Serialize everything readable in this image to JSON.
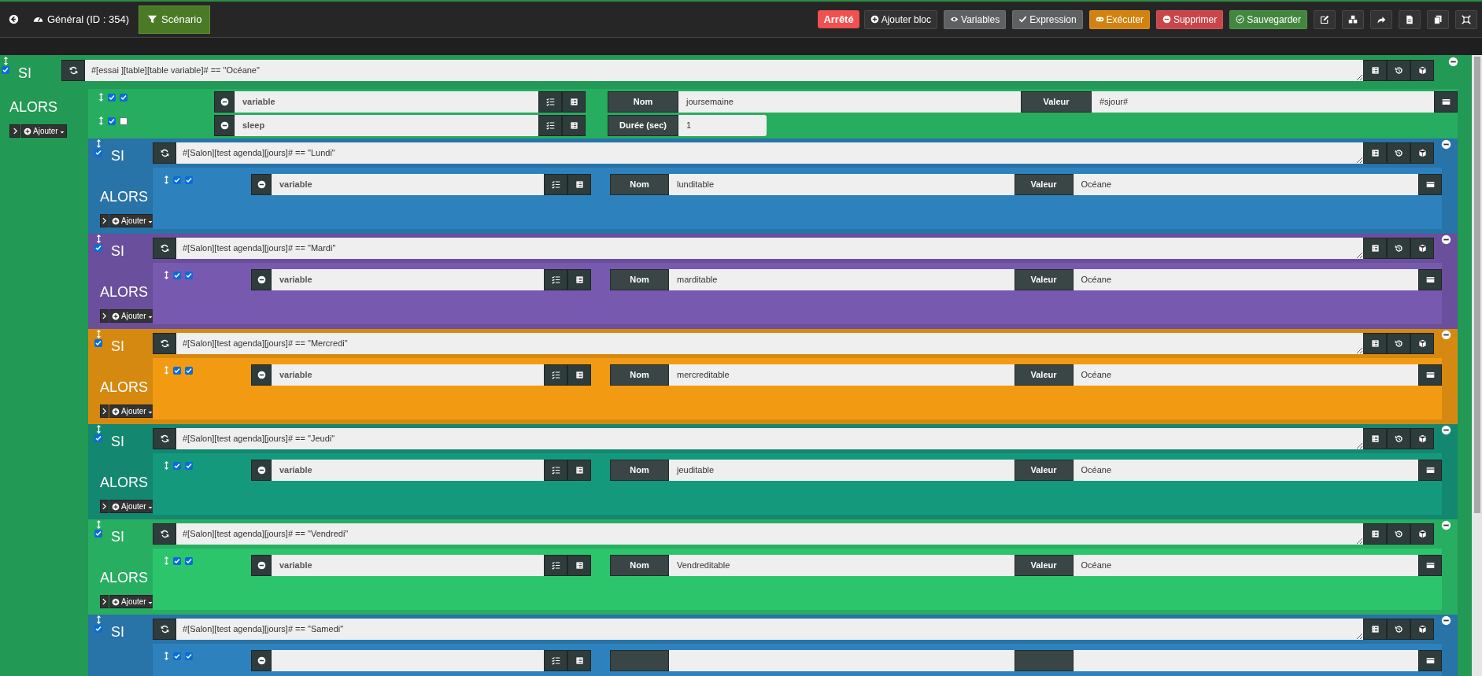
{
  "tabs": [
    {
      "label": "Général (ID : 354)",
      "selected": false
    },
    {
      "label": "Scénario",
      "selected": true
    }
  ],
  "status": "Arrêté",
  "toolbar": [
    {
      "label": "Ajouter bloc",
      "color": "#333333"
    },
    {
      "label": "Variables",
      "color": "#5e6162"
    },
    {
      "label": "Expression",
      "color": "#5e6162"
    },
    {
      "label": "Exécuter",
      "color": "#d4820f"
    },
    {
      "label": "Supprimer",
      "color": "#c9454a"
    },
    {
      "label": "Sauvegarder",
      "color": "#43873f"
    }
  ],
  "scenario": {
    "keyword": "SI",
    "checked": true,
    "condition": "#[essai ][table][table variable]# == \"Océane\"",
    "color": "#229954",
    "then_label": "ALORS",
    "add_label": "Ajouter",
    "actions": [
      {
        "kind": "variable",
        "enabled": true,
        "parallel": true,
        "command": "variable",
        "fields": [
          {
            "label": "Nom",
            "value": "joursemaine"
          },
          {
            "label": "Valeur",
            "value": "#sjour#"
          }
        ]
      },
      {
        "kind": "sleep",
        "enabled": true,
        "parallel": false,
        "command": "sleep",
        "fields": [
          {
            "label": "Durée (sec)",
            "value": "1"
          }
        ]
      },
      {
        "kind": "block",
        "keyword": "SI",
        "checked": true,
        "condition": "#[Salon][test agenda][jours]# == \"Lundi\"",
        "color": "#2873a8",
        "then_label": "ALORS",
        "add_label": "Ajouter",
        "actions": [
          {
            "kind": "variable",
            "enabled": true,
            "parallel": true,
            "command": "variable",
            "fields": [
              {
                "label": "Nom",
                "value": "lunditable"
              },
              {
                "label": "Valeur",
                "value": "Océane"
              }
            ]
          }
        ]
      },
      {
        "kind": "block",
        "keyword": "SI",
        "checked": true,
        "condition": "#[Salon][test agenda][jours]# == \"Mardi\"",
        "color": "#6a4f9c",
        "then_label": "ALORS",
        "add_label": "Ajouter",
        "actions": [
          {
            "kind": "variable",
            "enabled": true,
            "parallel": true,
            "command": "variable",
            "fields": [
              {
                "label": "Nom",
                "value": "marditable"
              },
              {
                "label": "Valeur",
                "value": "Océane"
              }
            ]
          }
        ]
      },
      {
        "kind": "block",
        "keyword": "SI",
        "checked": true,
        "condition": "#[Salon][test agenda][jours]# == \"Mercredi\"",
        "color": "#d68910",
        "then_label": "ALORS",
        "add_label": "Ajouter",
        "actions": [
          {
            "kind": "variable",
            "enabled": true,
            "parallel": true,
            "command": "variable",
            "fields": [
              {
                "label": "Nom",
                "value": "mercreditable"
              },
              {
                "label": "Valeur",
                "value": "Océane"
              }
            ]
          }
        ]
      },
      {
        "kind": "block",
        "keyword": "SI",
        "checked": true,
        "condition": "#[Salon][test agenda][jours]# == \"Jeudi\"",
        "color": "#13876f",
        "then_label": "ALORS",
        "add_label": "Ajouter",
        "actions": [
          {
            "kind": "variable",
            "enabled": true,
            "parallel": true,
            "command": "variable",
            "fields": [
              {
                "label": "Nom",
                "value": "jeuditable"
              },
              {
                "label": "Valeur",
                "value": "Océane"
              }
            ]
          }
        ]
      },
      {
        "kind": "block",
        "keyword": "SI",
        "checked": true,
        "condition": "#[Salon][test agenda][jours]# == \"Vendredi\"",
        "color": "#27ae60",
        "then_label": "ALORS",
        "add_label": "Ajouter",
        "actions": [
          {
            "kind": "variable",
            "enabled": true,
            "parallel": true,
            "command": "variable",
            "fields": [
              {
                "label": "Nom",
                "value": "Vendreditable"
              },
              {
                "label": "Valeur",
                "value": "Océane"
              }
            ]
          }
        ]
      },
      {
        "kind": "block",
        "keyword": "SI",
        "checked": true,
        "condition": "#[Salon][test agenda][jours]# == \"Samedi\"",
        "color": "#2873a8",
        "actions": [
          {
            "kind": "variable",
            "enabled": true,
            "parallel": true
          }
        ]
      }
    ]
  }
}
